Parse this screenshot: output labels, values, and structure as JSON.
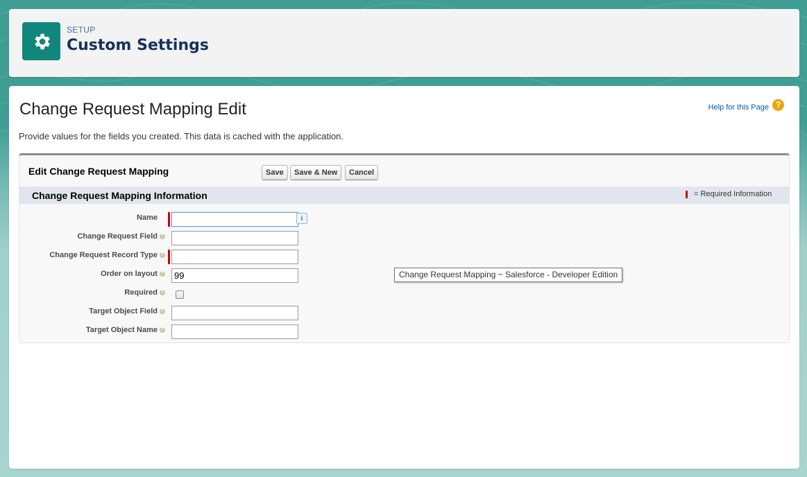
{
  "header": {
    "setup_label": "SETUP",
    "title": "Custom Settings",
    "icon": "gear-icon"
  },
  "page": {
    "title": "Change Request Mapping Edit",
    "help_link": "Help for this Page",
    "help_icon": "question-icon",
    "description": "Provide values for the fields you created. This data is cached with the application."
  },
  "edit_block": {
    "title": "Edit Change Request Mapping",
    "buttons": {
      "save": "Save",
      "save_new": "Save & New",
      "cancel": "Cancel"
    }
  },
  "section": {
    "title": "Change Request Mapping Information",
    "required_legend": "= Required Information"
  },
  "fields": {
    "name": {
      "label": "Name",
      "value": "",
      "required": true
    },
    "change_request_field": {
      "label": "Change Request Field",
      "value": ""
    },
    "change_request_record_type": {
      "label": "Change Request Record Type",
      "value": "",
      "required": true
    },
    "order_on_layout": {
      "label": "Order on layout",
      "value": "99"
    },
    "required": {
      "label": "Required",
      "checked": false
    },
    "target_object_field": {
      "label": "Target Object Field",
      "value": ""
    },
    "target_object_name": {
      "label": "Target Object Name",
      "value": ""
    }
  },
  "tooltip": {
    "text": "Change Request Mapping ~ Salesforce - Developer Edition"
  },
  "colors": {
    "brand_teal": "#11877c",
    "background_teal": "#3f9e94",
    "required_red": "#cc0000",
    "link_blue": "#015ba7",
    "section_header": "#e1e6ee"
  }
}
